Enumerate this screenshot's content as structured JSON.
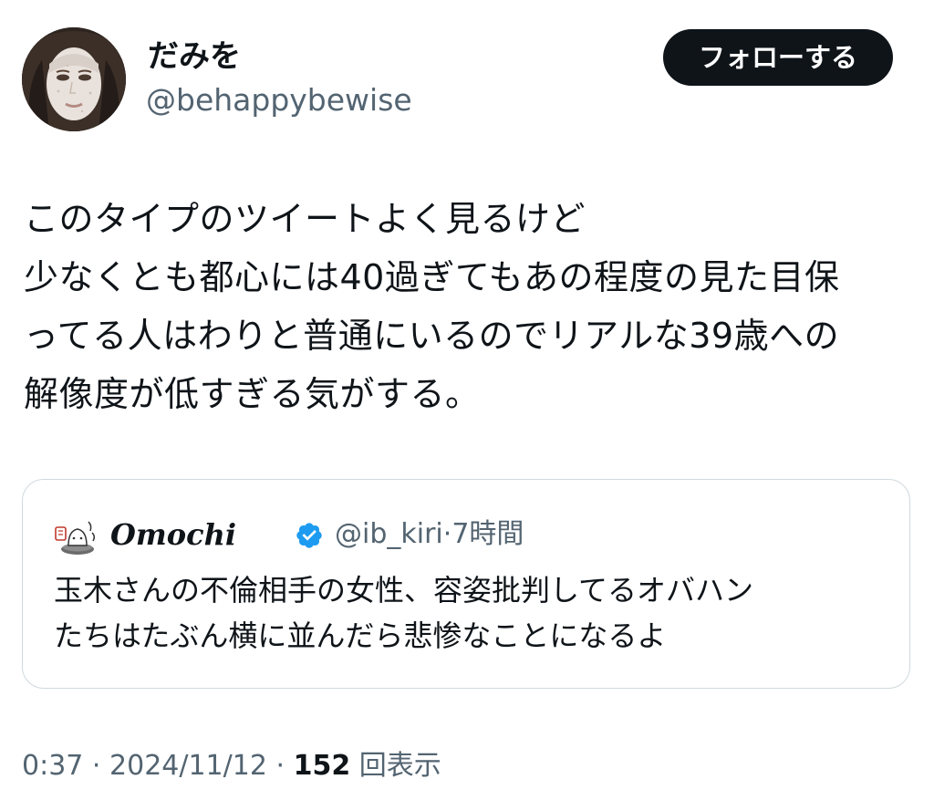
{
  "author": {
    "display_name": "だみを",
    "handle": "@behappybewise"
  },
  "follow_button": {
    "label": "フォローする"
  },
  "tweet": {
    "lines": [
      "このタイプのツイートよく見るけど",
      "少なくとも都心には40過ぎてもあの程度の見た目保",
      "ってる人はわりと普通にいるのでリアルな39歳への",
      "解像度が低すぎる気がする。"
    ]
  },
  "quote": {
    "display_name": "Omochi",
    "handle": "@ib_kiri",
    "separator": "·",
    "time": "7時間",
    "lines": [
      "玉木さんの不倫相手の女性、容姿批判してるオバハン",
      "たちはたぶん横に並んだら悲惨なことになるよ"
    ]
  },
  "meta": {
    "time": "0:37",
    "sep1": "·",
    "date": "2024/11/12",
    "sep2": "·",
    "views_count": "152",
    "views_label": "回表示"
  },
  "colors": {
    "text": "#0f1419",
    "secondary": "#536471",
    "border": "#cfd9de",
    "verified": "#1d9bf0",
    "button_bg": "#0f1419"
  }
}
